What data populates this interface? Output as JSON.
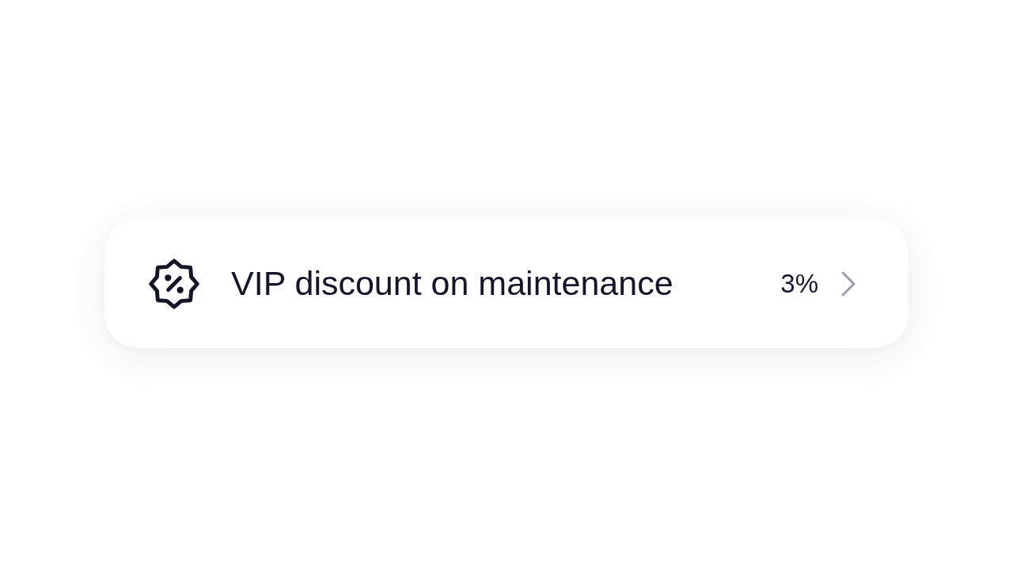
{
  "item": {
    "label": "VIP discount on maintenance",
    "value": "3%"
  }
}
